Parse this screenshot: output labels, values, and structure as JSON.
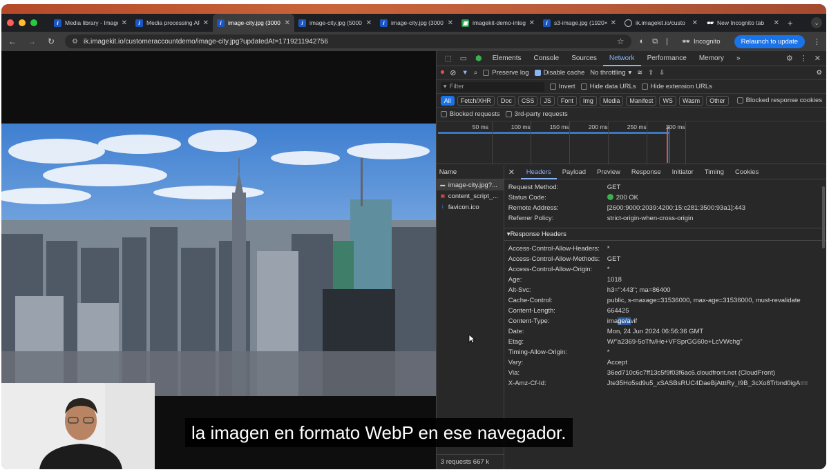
{
  "browser": {
    "tabs": [
      {
        "title": "Media library - Image",
        "icon": "imagekit"
      },
      {
        "title": "Media processing AP",
        "icon": "imagekit"
      },
      {
        "title": "image-city.jpg (3000",
        "icon": "imagekit",
        "active": true
      },
      {
        "title": "image-city.jpg (5000",
        "icon": "imagekit"
      },
      {
        "title": "image-city.jpg (3000",
        "icon": "imagekit"
      },
      {
        "title": "imagekit-demo-integ",
        "icon": "green"
      },
      {
        "title": "s3-image.jpg (1920×",
        "icon": "imagekit"
      },
      {
        "title": "ik.imagekit.io/custo",
        "icon": "globe"
      },
      {
        "title": "New Incognito tab",
        "icon": "incognito"
      }
    ],
    "new_tab": "+",
    "url": "ik.imagekit.io/customeraccountdemo/image-city.jpg?updatedAt=1719211942756",
    "incognito_label": "Incognito",
    "relaunch_label": "Relaunch to update",
    "colors": {
      "accent": "#1a73e8",
      "ok": "#3bb04d"
    }
  },
  "devtools": {
    "tabs": [
      "Elements",
      "Console",
      "Sources",
      "Network",
      "Performance",
      "Memory"
    ],
    "more": "»",
    "selected_tab": "Network",
    "toolbar": {
      "preserve_log": "Preserve log",
      "disable_cache": "Disable cache",
      "throttling": "No throttling"
    },
    "filter": {
      "placeholder": "Filter",
      "invert": "Invert",
      "hide_data_urls": "Hide data URLs",
      "hide_extension_urls": "Hide extension URLs"
    },
    "type_chips": [
      "All",
      "Fetch/XHR",
      "Doc",
      "CSS",
      "JS",
      "Font",
      "Img",
      "Media",
      "Manifest",
      "WS",
      "Wasm",
      "Other"
    ],
    "blocked_response_cookies": "Blocked response cookies",
    "blocked_requests": "Blocked requests",
    "third_party": "3rd-party requests",
    "timeline_ticks": [
      "50 ms",
      "100 ms",
      "150 ms",
      "200 ms",
      "250 ms",
      "300 ms"
    ],
    "name_header": "Name",
    "requests": [
      {
        "name": "image-city.jpg?...",
        "icon": "image"
      },
      {
        "name": "content_script_...",
        "icon": "script"
      },
      {
        "name": "favicon.ico",
        "icon": "imagekit"
      }
    ],
    "footer": "3 requests   667 k",
    "detail_tabs": [
      "Headers",
      "Payload",
      "Preview",
      "Response",
      "Initiator",
      "Timing",
      "Cookies"
    ],
    "general": [
      {
        "k": "Request Method:",
        "v": "GET"
      },
      {
        "k": "Status Code:",
        "v": "200 OK"
      },
      {
        "k": "Remote Address:",
        "v": "[2600:9000:2039:4200:15:c281:3500:93a1]:443"
      },
      {
        "k": "Referrer Policy:",
        "v": "strict-origin-when-cross-origin"
      }
    ],
    "response_headers_title": "▾Response Headers",
    "response_headers": [
      {
        "k": "Access-Control-Allow-Headers:",
        "v": "*"
      },
      {
        "k": "Access-Control-Allow-Methods:",
        "v": "GET"
      },
      {
        "k": "Access-Control-Allow-Origin:",
        "v": "*"
      },
      {
        "k": "Age:",
        "v": "1018"
      },
      {
        "k": "Alt-Svc:",
        "v": "h3=\":443\"; ma=86400"
      },
      {
        "k": "Cache-Control:",
        "v": "public, s-maxage=31536000, max-age=31536000, must-revalidate"
      },
      {
        "k": "Content-Length:",
        "v": "664425"
      },
      {
        "k": "Content-Type:",
        "v_pre": "ima",
        "v_hl": "ge/a",
        "v_post": "vif"
      },
      {
        "k": "Date:",
        "v": "Mon, 24 Jun 2024 06:56:36 GMT"
      },
      {
        "k": "Etag:",
        "v": "W/\"a2369-5oTfv/He+VFSprGG60o+LcVWchg\""
      },
      {
        "k": "Timing-Allow-Origin:",
        "v": "*"
      },
      {
        "k": "Vary:",
        "v": "Accept"
      },
      {
        "k": "Via:",
        "v": "36ed710c6c7ff13c5f9f03f6ac6.cloudfront.net (CloudFront)"
      },
      {
        "k": "X-Amz-Cf-Id:",
        "v": "Jte35Ho5sd9u5_xSASBsRUC4DaeBjAtttRy_I9B_3cXo8Trbnd0igA=="
      }
    ]
  },
  "subtitle": "la imagen en formato WebP en ese navegador."
}
